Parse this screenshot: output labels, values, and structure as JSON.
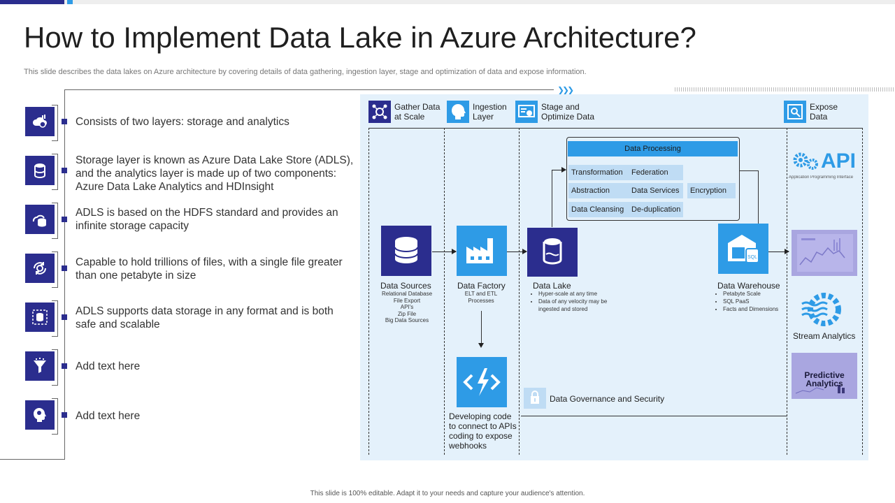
{
  "title": "How to Implement Data Lake in Azure Architecture?",
  "subtitle": "This slide describes the data lakes on Azure architecture by covering details of data gathering, ingestion layer, stage and optimization of data and expose information.",
  "footer": "This slide is 100% editable. Adapt it to your needs and capture your audience's attention.",
  "colors": {
    "primary": "#2b2d8e",
    "accent": "#2e9be6",
    "panel": "#e4f1fb",
    "chip": "#bfdcf4"
  },
  "left_items": [
    {
      "icon": "cloud-data-icon",
      "text": "Consists of two layers: storage and analytics"
    },
    {
      "icon": "database-icon",
      "text": "Storage layer is known as Azure Data Lake Store (ADLS), and the analytics layer is made up of two components: Azure Data Lake Analytics and HDInsight"
    },
    {
      "icon": "hybrid-storage-icon",
      "text": "ADLS is based on the HDFS standard and provides an infinite storage capacity"
    },
    {
      "icon": "sync-gear-icon",
      "text": "Capable to hold trillions of files, with a single file greater than one petabyte in size"
    },
    {
      "icon": "secure-database-icon",
      "text": "ADLS supports data storage in any format and is both safe and scalable"
    },
    {
      "icon": "funnel-icon",
      "text": "Add text here"
    },
    {
      "icon": "head-idea-icon",
      "text": "Add text here"
    }
  ],
  "columns": {
    "gather": "Gather Data at Scale",
    "ingest": "Ingestion Layer",
    "stage": "Stage and Optimize Data",
    "expose": "Expose Data"
  },
  "nodes": {
    "sources": {
      "label": "Data Sources",
      "details": [
        "Relational Database",
        "File Export",
        "API's",
        "Zip File",
        "Big Data Sources"
      ]
    },
    "factory": {
      "label": "Data Factory",
      "details": [
        "ELT and ETL",
        "Processes"
      ]
    },
    "lake": {
      "label": "Data Lake",
      "details": [
        "Hyper-scale at any time",
        "Data of any velocity may be ingested and stored"
      ]
    },
    "warehouse": {
      "label": "Data Warehouse",
      "details": [
        "Petabyte Scale",
        "SQL PaaS",
        "Facts and Dimensions"
      ]
    },
    "functions": {
      "label": "Developing code to connect to APIs coding to expose webhooks"
    }
  },
  "processing": {
    "title": "Data Processing",
    "chips": [
      "Transformation",
      "Federation",
      "Abstraction",
      "Data Services",
      "Encryption",
      "Data Cleansing",
      "De-duplication"
    ]
  },
  "governance": "Data Governance and Security",
  "expose_items": {
    "api_big": "API",
    "api_caption": "Application Programming Interface",
    "stream": "Stream Analytics",
    "predictive": "Predictive Analytics"
  }
}
